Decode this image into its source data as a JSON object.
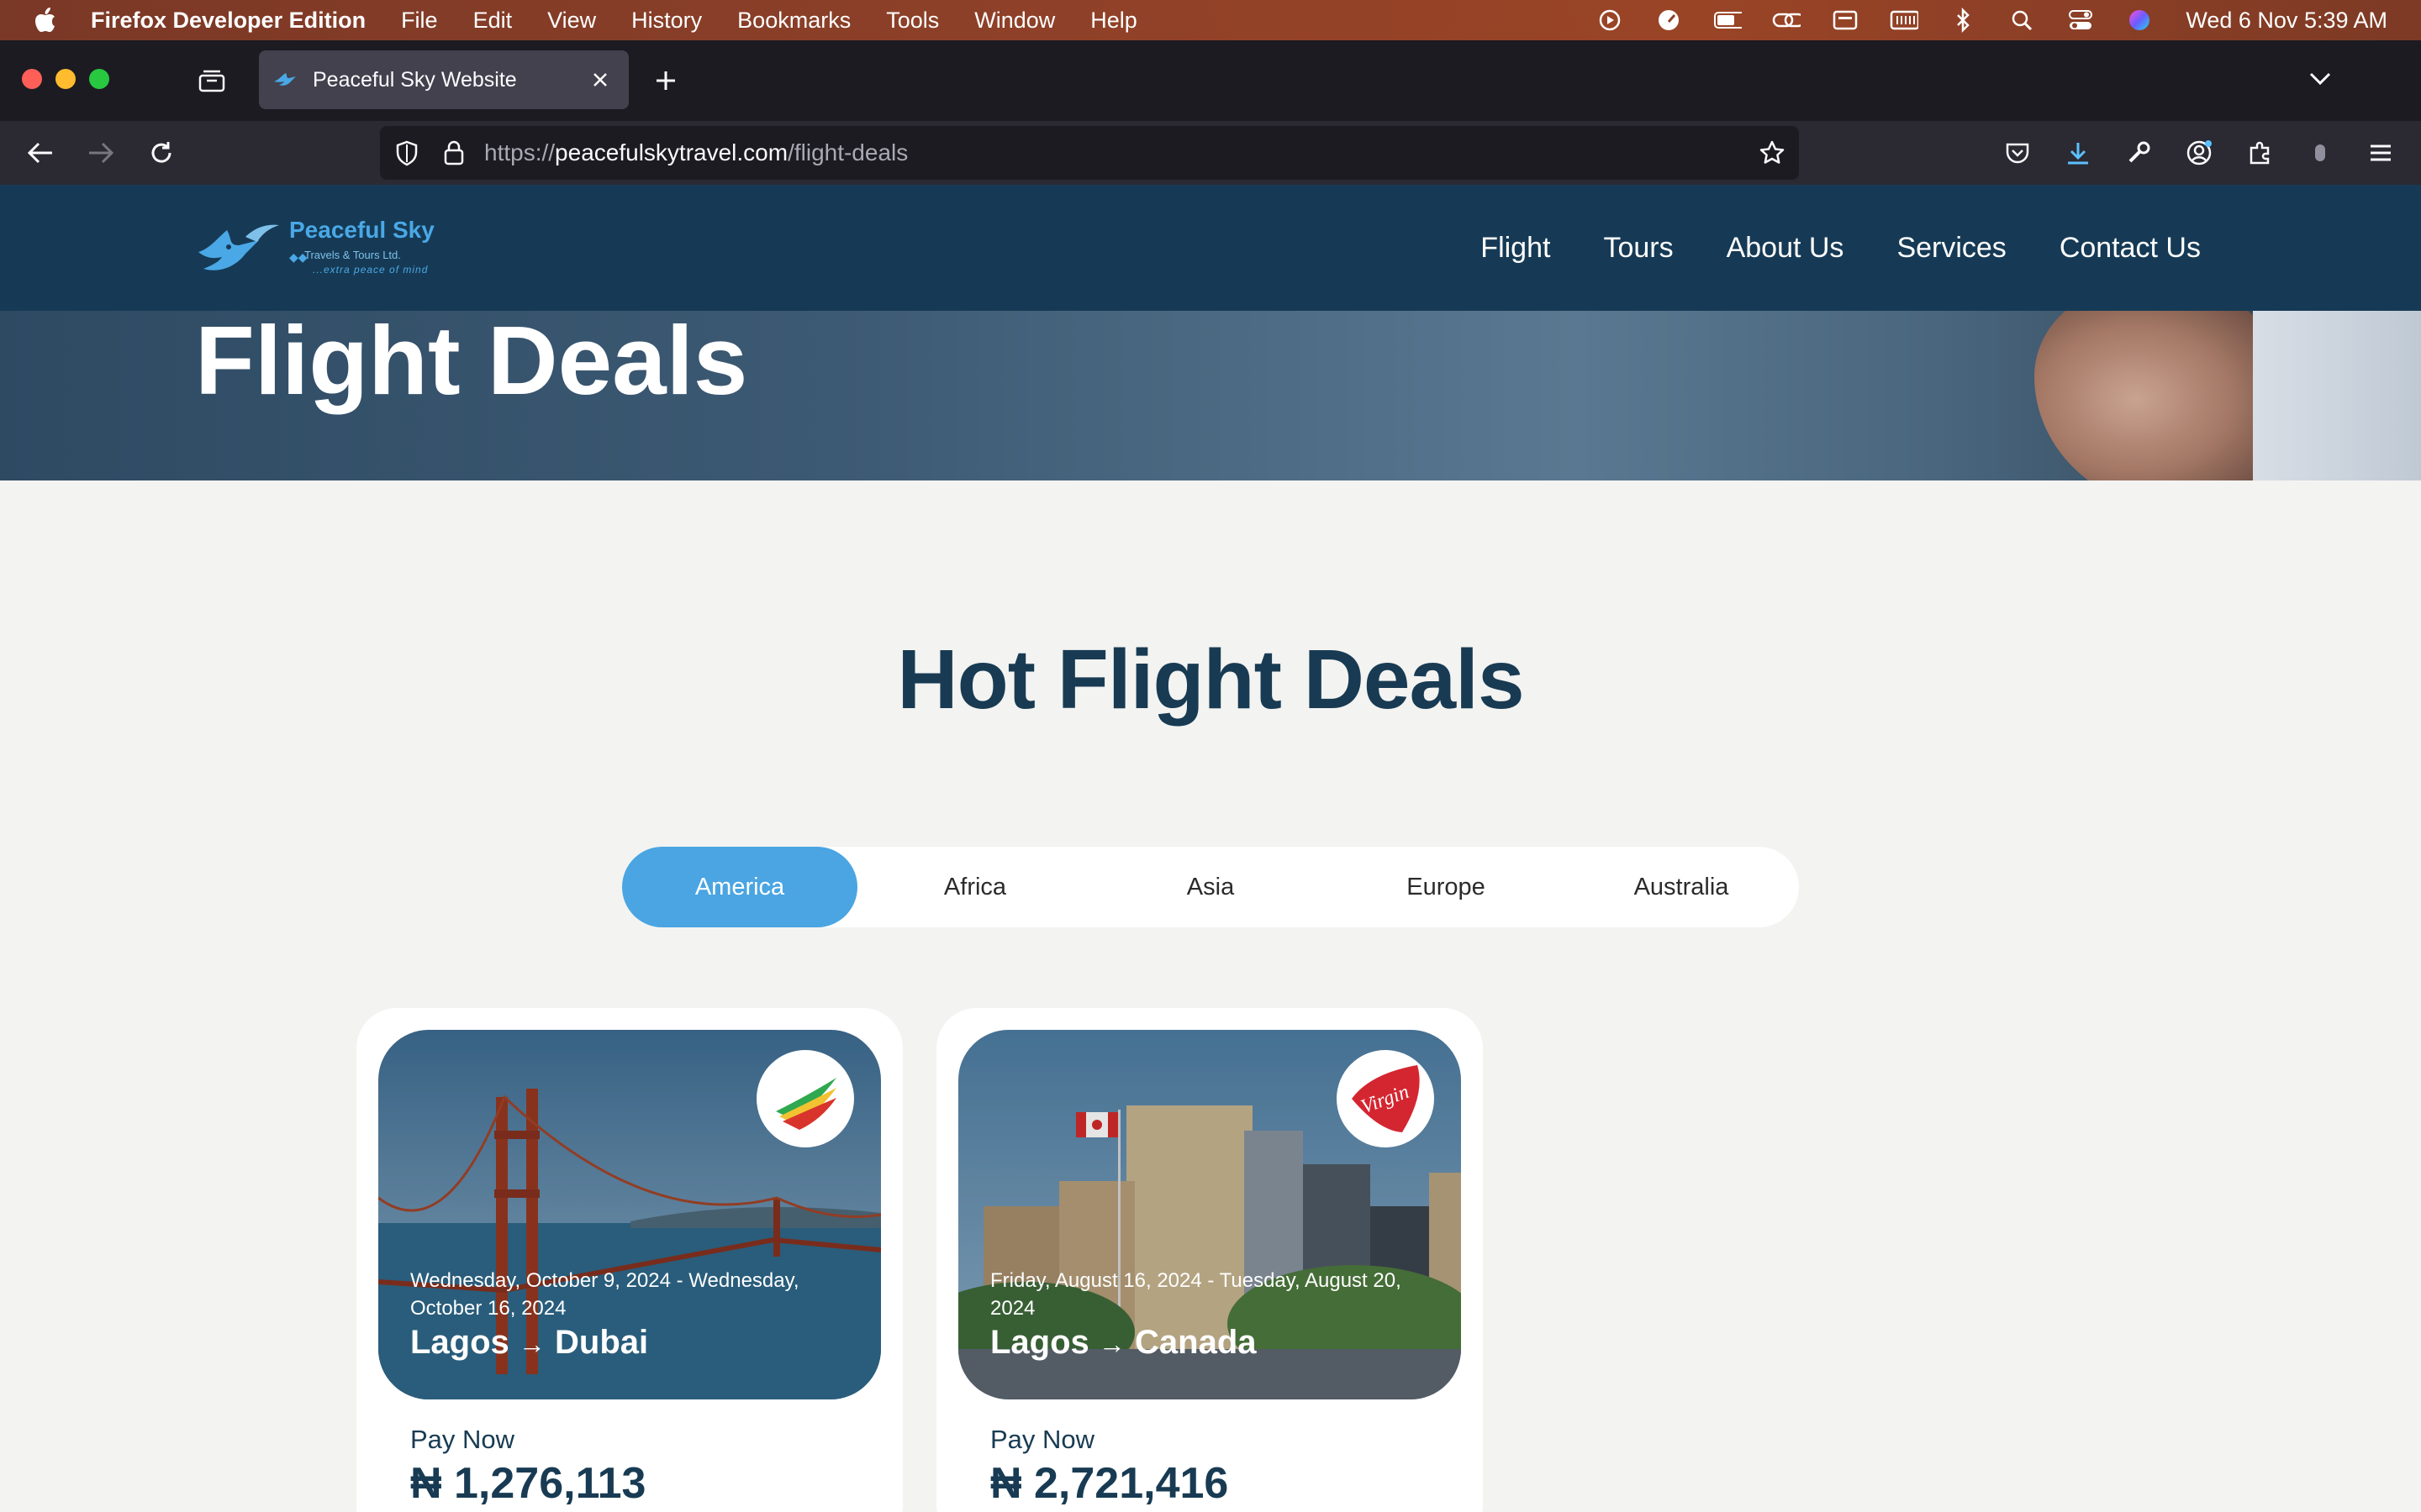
{
  "menubar": {
    "app_name": "Firefox Developer Edition",
    "items": [
      "File",
      "Edit",
      "View",
      "History",
      "Bookmarks",
      "Tools",
      "Window",
      "Help"
    ],
    "clock": "Wed 6 Nov  5:39 AM"
  },
  "browser": {
    "tab_title": "Peaceful Sky Website",
    "url_scheme": "https://",
    "url_host": "peacefulskytravel.com",
    "url_path": "/flight-deals"
  },
  "site": {
    "logo": {
      "brand": "Peaceful Sky",
      "sub": "Travels & Tours Ltd.",
      "tagline": "...extra peace of mind"
    },
    "nav": [
      "Flight",
      "Tours",
      "About Us",
      "Services",
      "Contact Us"
    ],
    "hero_title": "Flight Deals",
    "section_title": "Hot Flight Deals",
    "regions": [
      "America",
      "Africa",
      "Asia",
      "Europe",
      "Australia"
    ],
    "active_region": "America",
    "deals": [
      {
        "dates": "Wednesday, October 9, 2024 - Wednesday, October 16, 2024",
        "origin": "Lagos",
        "destination": "Dubai",
        "pay_label": "Pay Now",
        "price": "₦ 1,276,113",
        "airline_logo": "ethiopian-airlines-logo"
      },
      {
        "dates": "Friday, August 16, 2024 - Tuesday, August 20, 2024",
        "origin": "Lagos",
        "destination": "Canada",
        "pay_label": "Pay Now",
        "price": "₦ 2,721,416",
        "airline_logo": "virgin-atlantic-logo",
        "airline_logo_text": "Virgin"
      }
    ]
  },
  "colors": {
    "header_bg": "#163a55",
    "accent": "#4aa5e2",
    "heading": "#183b53"
  }
}
